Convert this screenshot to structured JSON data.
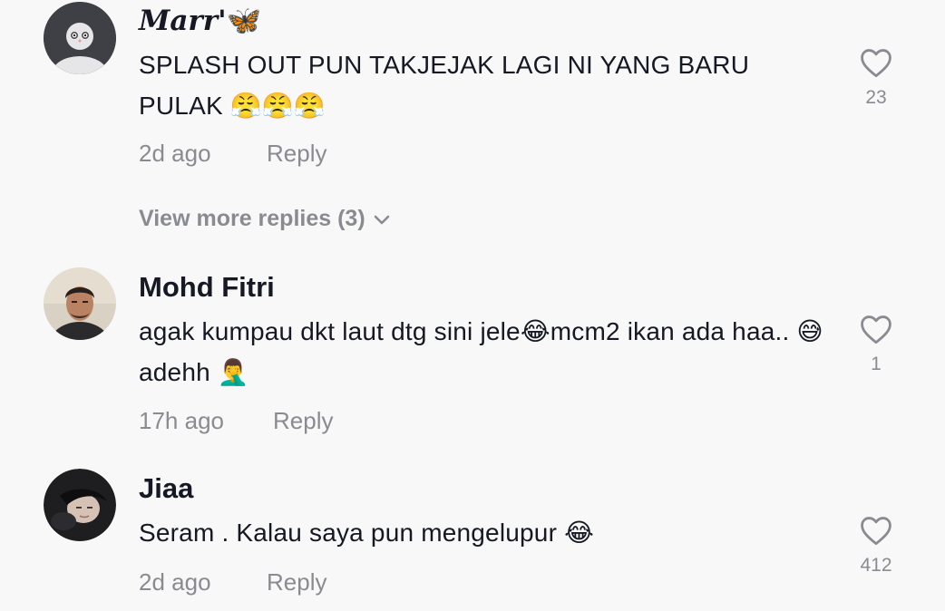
{
  "comments": [
    {
      "username": "Marr'",
      "username_emoji": "🦋",
      "text": "SPLASH OUT PUN TAKJEJAK LAGI NI YANG BARU PULAK 😤😤😤",
      "time": "2d ago",
      "reply": "Reply",
      "likes": "23",
      "view_more": "View more replies (3)"
    },
    {
      "username": "Mohd Fitri",
      "text": "agak kumpau dkt laut dtg sini jele😂mcm2 ikan ada haa.. 😅adehh 🤦‍♂️",
      "time": "17h ago",
      "reply": "Reply",
      "likes": "1"
    },
    {
      "username": "Jiaa",
      "text": "Seram . Kalau saya pun mengelupur 😂",
      "time": "2d ago",
      "reply": "Reply",
      "likes": "412"
    }
  ],
  "icons": {
    "like": "heart-outline-icon",
    "expand": "chevron-down-icon"
  },
  "colors": {
    "background": "#f8f8f8",
    "primary_text": "#161823",
    "secondary_text": "#8a8b91"
  }
}
